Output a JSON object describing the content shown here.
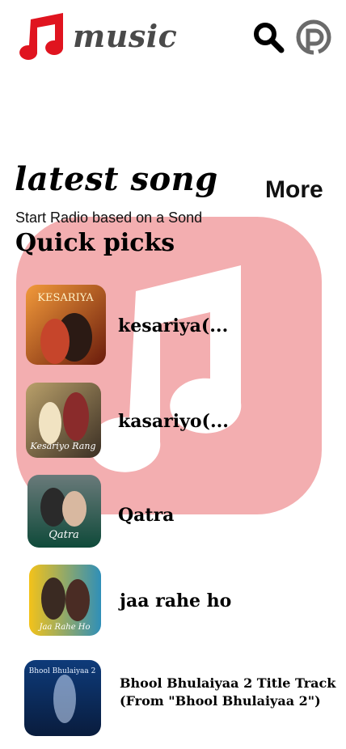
{
  "header": {
    "brand": "music",
    "icons": [
      "music-note-logo-icon",
      "search-icon",
      "pinterest-p-icon"
    ],
    "accent": "#e0141f"
  },
  "section": {
    "heading": "latest song",
    "more_label": "More",
    "subtitle": "Start Radio based on a Sond",
    "list_title": "Quick picks"
  },
  "songs": [
    {
      "title": "kesariya(...",
      "art_text": "KESARIYA"
    },
    {
      "title": "kasariyo(...",
      "art_text": "Kesariyo Rang"
    },
    {
      "title": "Qatra",
      "art_text": "Qatra"
    },
    {
      "title": "jaa rahe ho",
      "art_text": "Jaa Rahe Ho"
    },
    {
      "title": "Bhool Bhulaiyaa 2 Title Track (From \"Bhool Bhulaiyaa 2\")",
      "art_text": "Bhool Bhulaiyaa 2"
    }
  ],
  "colors": {
    "watermark": "#f3aeb0",
    "logo": "#e0141f",
    "icon_gray": "#6b6b6b"
  }
}
